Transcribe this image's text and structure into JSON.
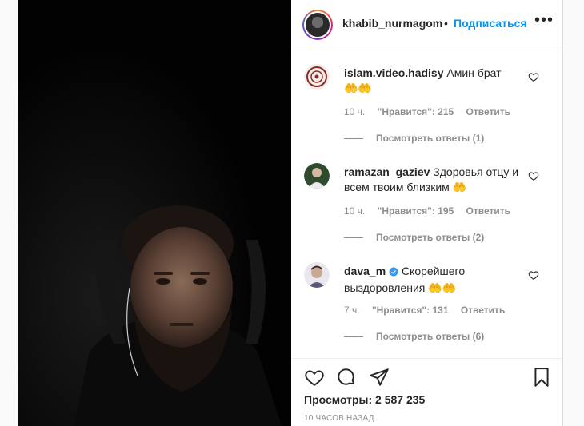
{
  "post": {
    "username": "khabib_nurmagomedov",
    "separator": "•",
    "follow_label": "Подписаться",
    "more_label": "•••"
  },
  "comments": [
    {
      "username": "islam.video.hadisy",
      "text": "Амин брат",
      "emoji": "🤲🤲",
      "time": "10 ч.",
      "likes": "\"Нравится\": 215",
      "reply_label": "Ответить",
      "view_replies": "Посмотреть ответы (1)"
    },
    {
      "username": "ramazan_gaziev",
      "text": "Здоровья отцу и всем твоим близким",
      "emoji": "🤲",
      "time": "10 ч.",
      "likes": "\"Нравится\": 195",
      "reply_label": "Ответить",
      "view_replies": "Посмотреть ответы (2)"
    },
    {
      "username": "dava_m",
      "verified": true,
      "text": "Скорейшего выздоровления",
      "emoji": "🤲🤲",
      "time": "7 ч.",
      "likes": "\"Нравится\": 131",
      "reply_label": "Ответить",
      "view_replies": "Посмотреть ответы (6)"
    }
  ],
  "footer": {
    "views": "Просмотры: 2 587 235",
    "time_ago": "10 ЧАСОВ НАЗАД"
  },
  "colors": {
    "accent": "#0095f6",
    "muted": "#8e8e8e",
    "text": "#262626"
  }
}
